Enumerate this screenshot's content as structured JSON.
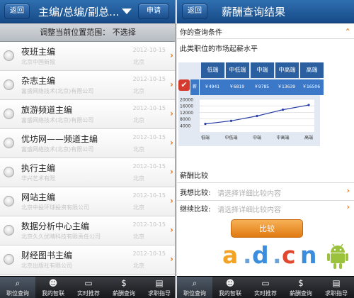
{
  "left": {
    "header": {
      "back": "返回",
      "title": "主编/总编/副总...",
      "apply": "申请"
    },
    "range_label": "调整当前位置范围：  不选择",
    "jobs": [
      {
        "title": "夜班主编",
        "company": "北京中国新报",
        "date": "2012-10-15",
        "city": "北京"
      },
      {
        "title": "杂志主编",
        "company": "富盛网络技术(北京)有限公司",
        "date": "2012-10-15",
        "city": "北京"
      },
      {
        "title": "旅游频道主编",
        "company": "富盛网络技术(北京)有限公司",
        "date": "2012-10-15",
        "city": "北京"
      },
      {
        "title": "优坊网——频道主编",
        "company": "富盛网络技术(北京)有限公司",
        "date": "2012-10-15",
        "city": "北京"
      },
      {
        "title": "执行主编",
        "company": "华兴艺术有限",
        "date": "2012-10-15",
        "city": "北京"
      },
      {
        "title": "网站主编",
        "company": "北京中投环球投资有限公司",
        "date": "2012-10-15",
        "city": "北京"
      },
      {
        "title": "数据分析中心主编",
        "company": "北京久久优晴科技有限责任公司",
        "date": "2012-10-15",
        "city": "北京"
      },
      {
        "title": "财经图书主编",
        "company": "北京出版社有限公司",
        "date": "2012-10-15",
        "city": "北京"
      }
    ],
    "tabs": [
      "职位查询",
      "我的智联",
      "实时推荐",
      "薪酬查询",
      "求职指导"
    ]
  },
  "right": {
    "header": {
      "back": "返回",
      "title": "薪酬查询结果"
    },
    "query_label": "你的查询条件",
    "market_label": "此类职位的市场起薪水平",
    "table_headers": [
      "低端",
      "中低端",
      "中端",
      "中高端",
      "高端"
    ],
    "row_prefix": "薪",
    "table_values": [
      "￥4941",
      "￥6819",
      "￥9785",
      "￥13639",
      "￥16506"
    ],
    "compare_title": "薪酬比较",
    "want_label": "我想比较:",
    "continue_label": "继续比较:",
    "placeholder": "请选择详细比较内容",
    "compare_button": "比较",
    "tabs": [
      "职位查询",
      "我的智联",
      "实时推荐",
      "薪酬查询",
      "求职指导"
    ]
  },
  "chart_data": {
    "type": "line",
    "categories": [
      "低端",
      "中低端",
      "中端",
      "中高端",
      "高端"
    ],
    "series": [
      {
        "values": [
          4941,
          6819,
          9785,
          13639,
          16506
        ]
      }
    ],
    "ytick_labels": [
      "20000",
      "16000",
      "12000",
      "8000",
      "4000"
    ],
    "ylim": [
      0,
      20000
    ],
    "color": "#2a3fa8"
  },
  "watermark": [
    "a",
    ".",
    "d",
    ".",
    "c",
    "n"
  ],
  "colors": {
    "header": "#1f5796",
    "accent": "#e8791c",
    "table": "#3b78c8"
  }
}
